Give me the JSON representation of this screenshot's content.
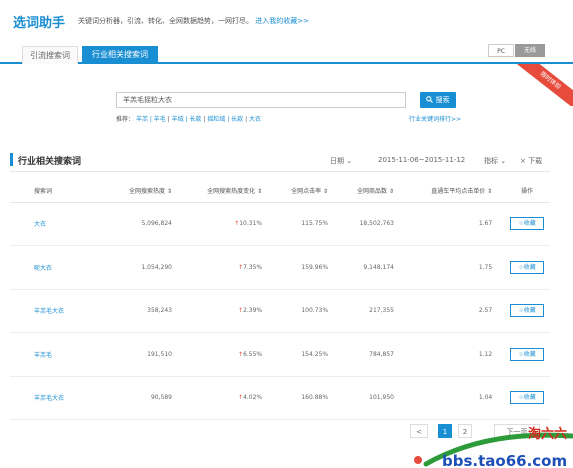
{
  "app": {
    "title": "选词助手",
    "tagline": "关键词分析器，引流、转化、全网数据趋势，一网打尽。",
    "tagline_link": "进入我的收藏>>"
  },
  "tabs": [
    {
      "label": "引流搜索词",
      "active": false
    },
    {
      "label": "行业相关搜索词",
      "active": true
    }
  ],
  "device_toggle": {
    "pc": "PC",
    "wireless": "无线"
  },
  "ribbon": {
    "label": "限时体验"
  },
  "search": {
    "value": "羊羔毛摇粒大衣",
    "button_label": "搜索",
    "hint_prefix": "推荐：",
    "hints": [
      "羊羔 | 羊毛",
      "羊绒 | 长款",
      "摇粒绒 | 长款",
      "大衣"
    ],
    "more_link": "行业关键词排行>>"
  },
  "section": {
    "title": "行业相关搜索词",
    "date_label": "日期",
    "date_range": "2015-11-06~2015-11-12",
    "metric_label": "指标",
    "download_label": "下载"
  },
  "table": {
    "headers": [
      "搜索词",
      "全网搜索热度",
      "全网搜索热度变化",
      "全网点击率",
      "全网商品数",
      "直通车平均点击单价",
      "操作"
    ],
    "rows": [
      {
        "keyword": "大衣",
        "heat": "5,096,824",
        "change": "10.31%",
        "ctr": "115.75%",
        "goods": "18,502,763",
        "cpc": "1.67",
        "action": "收藏"
      },
      {
        "keyword": "呢大衣",
        "heat": "1,054,290",
        "change": "7.35%",
        "ctr": "159.96%",
        "goods": "9,148,174",
        "cpc": "1.75",
        "action": "收藏"
      },
      {
        "keyword": "羊羔毛大衣",
        "heat": "358,243",
        "change": "2.39%",
        "ctr": "100.73%",
        "goods": "217,355",
        "cpc": "2.57",
        "action": "收藏"
      },
      {
        "keyword": "羊羔毛",
        "heat": "191,510",
        "change": "6.55%",
        "ctr": "154.25%",
        "goods": "784,857",
        "cpc": "1.12",
        "action": "收藏"
      },
      {
        "keyword": "羊羔毛大衣",
        "heat": "90,589",
        "change": "4.02%",
        "ctr": "160.88%",
        "goods": "101,950",
        "cpc": "1.04",
        "action": "收藏"
      }
    ]
  },
  "pagination": {
    "prev": "<",
    "pages": [
      "1",
      "2"
    ],
    "next": "下一页"
  },
  "watermark": {
    "text": "淘六六",
    "url": "bbs.tao66.com"
  },
  "colors": {
    "accent": "#1a8ed3",
    "ribbon": "#e64b3b",
    "up": "#e64b3b"
  }
}
